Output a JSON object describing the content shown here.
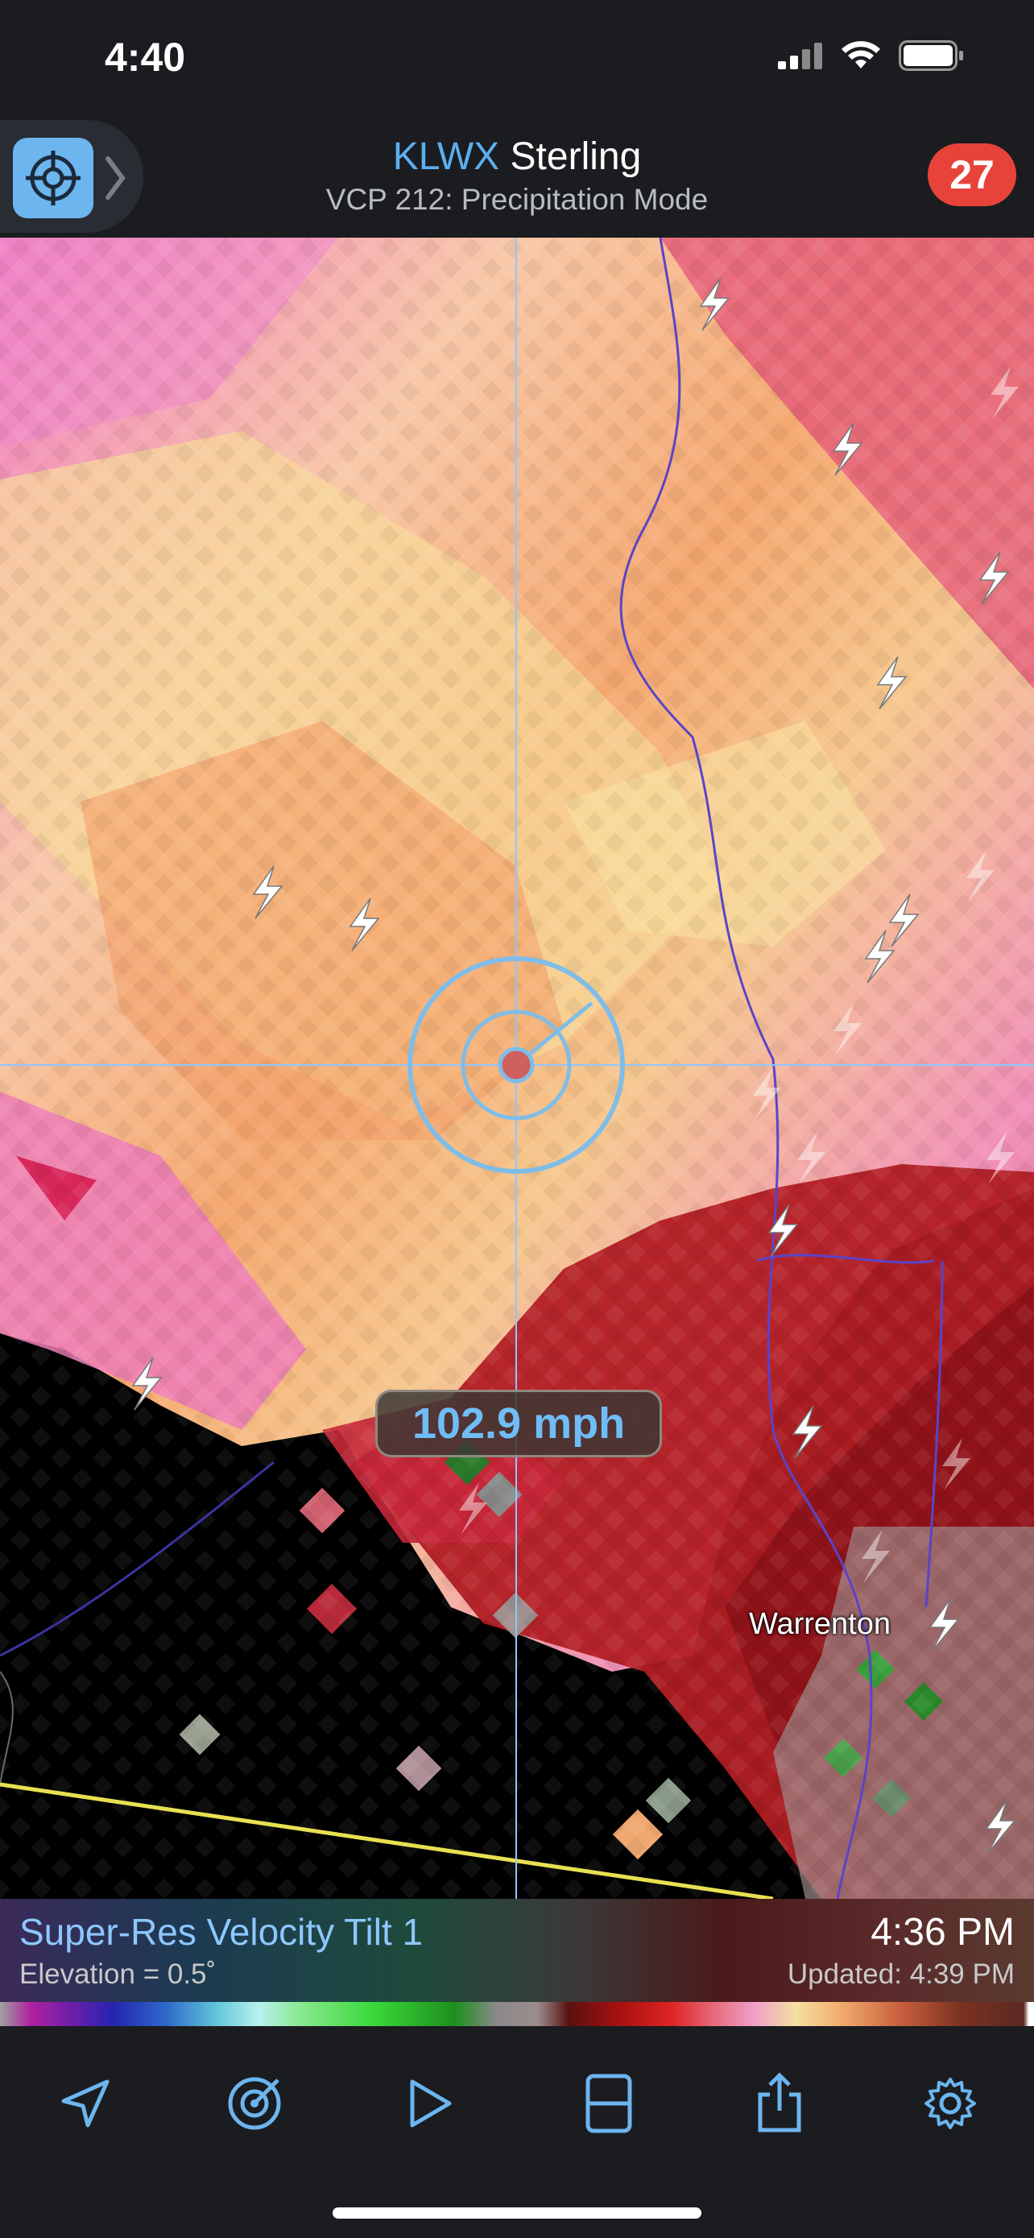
{
  "status_bar": {
    "time": "4:40"
  },
  "header": {
    "site_code": "KLWX",
    "site_name": "Sterling",
    "vcp": "VCP 212: Precipitation Mode",
    "alert_count": "27"
  },
  "map": {
    "cursor_readout": "102.9 mph",
    "city_label": "Warrenton"
  },
  "legend": {
    "product": "Super-Res Velocity Tilt 1",
    "elevation": "Elevation = 0.5˚",
    "scan_time": "4:36 PM",
    "updated": "Updated: 4:39 PM"
  },
  "toolbar": {
    "items": [
      "location-arrow-icon",
      "radar-sweep-icon",
      "play-icon",
      "split-view-icon",
      "share-icon",
      "gear-icon"
    ]
  },
  "colors": {
    "accent": "#5ab0f0",
    "alert": "#e8433a",
    "background": "#1b1c20"
  }
}
